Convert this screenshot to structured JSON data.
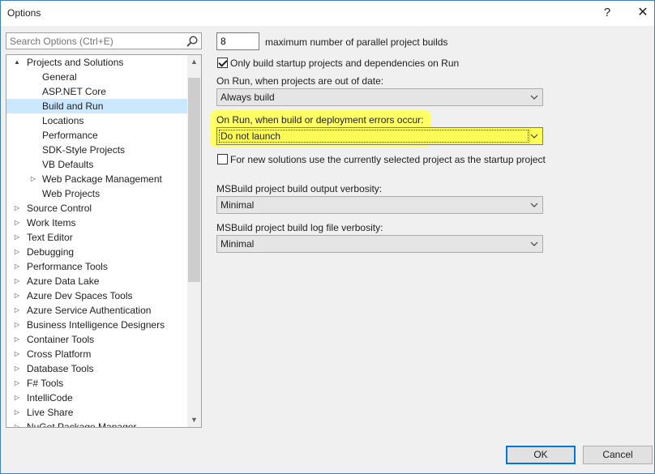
{
  "window": {
    "title": "Options",
    "help": "?",
    "close": "✕"
  },
  "search": {
    "placeholder": "Search Options (Ctrl+E)"
  },
  "tree": {
    "items": [
      {
        "label": "Projects and Solutions",
        "level": 0,
        "expander": "▲",
        "expanded": true
      },
      {
        "label": "General",
        "level": 1
      },
      {
        "label": "ASP.NET Core",
        "level": 1
      },
      {
        "label": "Build and Run",
        "level": 1,
        "selected": true
      },
      {
        "label": "Locations",
        "level": 1
      },
      {
        "label": "Performance",
        "level": 1
      },
      {
        "label": "SDK-Style Projects",
        "level": 1
      },
      {
        "label": "VB Defaults",
        "level": 1
      },
      {
        "label": "Web Package Management",
        "level": 1,
        "expander": "▷"
      },
      {
        "label": "Web Projects",
        "level": 1
      },
      {
        "label": "Source Control",
        "level": 0,
        "expander": "▷"
      },
      {
        "label": "Work Items",
        "level": 0,
        "expander": "▷"
      },
      {
        "label": "Text Editor",
        "level": 0,
        "expander": "▷"
      },
      {
        "label": "Debugging",
        "level": 0,
        "expander": "▷"
      },
      {
        "label": "Performance Tools",
        "level": 0,
        "expander": "▷"
      },
      {
        "label": "Azure Data Lake",
        "level": 0,
        "expander": "▷"
      },
      {
        "label": "Azure Dev Spaces Tools",
        "level": 0,
        "expander": "▷"
      },
      {
        "label": "Azure Service Authentication",
        "level": 0,
        "expander": "▷"
      },
      {
        "label": "Business Intelligence Designers",
        "level": 0,
        "expander": "▷"
      },
      {
        "label": "Container Tools",
        "level": 0,
        "expander": "▷"
      },
      {
        "label": "Cross Platform",
        "level": 0,
        "expander": "▷"
      },
      {
        "label": "Database Tools",
        "level": 0,
        "expander": "▷"
      },
      {
        "label": "F# Tools",
        "level": 0,
        "expander": "▷"
      },
      {
        "label": "IntelliCode",
        "level": 0,
        "expander": "▷"
      },
      {
        "label": "Live Share",
        "level": 0,
        "expander": "▷"
      },
      {
        "label": "NuGet Package Manager",
        "level": 0,
        "expander": "▷"
      }
    ],
    "scroll_up": "▲",
    "scroll_down": "▼"
  },
  "settings": {
    "parallel_builds_value": "8",
    "parallel_builds_label": "maximum number of parallel project builds",
    "only_build_startup_label": "Only build startup projects and dependencies on Run",
    "only_build_startup_checked": true,
    "out_of_date_label": "On Run, when projects are out of date:",
    "out_of_date_value": "Always build",
    "errors_label": "On Run, when build or deployment errors occur:",
    "errors_value": "Do not launch",
    "new_solutions_label": "For new solutions use the currently selected project as the startup project",
    "new_solutions_checked": false,
    "output_verbosity_label": "MSBuild project build output verbosity:",
    "output_verbosity_value": "Minimal",
    "log_verbosity_label": "MSBuild project build log file verbosity:",
    "log_verbosity_value": "Minimal"
  },
  "buttons": {
    "ok": "OK",
    "cancel": "Cancel"
  },
  "colors": {
    "highlight": "#ffff33",
    "selected_row": "#cce8ff",
    "accent": "#0078d7"
  }
}
